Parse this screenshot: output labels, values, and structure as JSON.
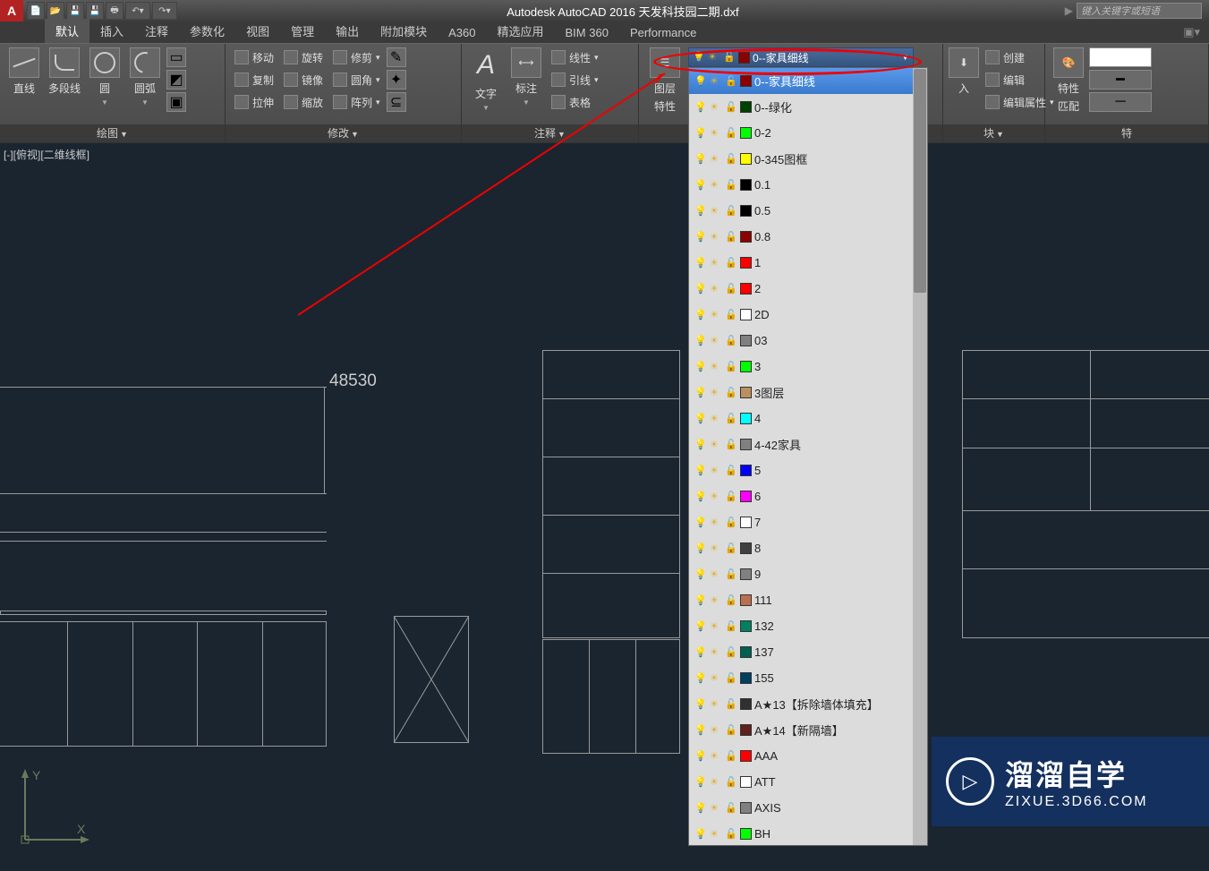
{
  "title": "Autodesk AutoCAD 2016   天发科技园二期.dxf",
  "search_placeholder": "键入关键字或短语",
  "tabs": [
    "默认",
    "插入",
    "注释",
    "参数化",
    "视图",
    "管理",
    "输出",
    "附加模块",
    "A360",
    "精选应用",
    "BIM 360",
    "Performance"
  ],
  "draw": {
    "line": "直线",
    "pline": "多段线",
    "circle": "圆",
    "arc": "圆弧",
    "panel": "绘图"
  },
  "modify": {
    "move": "移动",
    "copy": "复制",
    "stretch": "拉伸",
    "rotate": "旋转",
    "mirror": "镜像",
    "scale": "缩放",
    "trim": "修剪",
    "fillet": "圆角",
    "array": "阵列",
    "panel": "修改"
  },
  "annot": {
    "text": "文字",
    "dim": "标注",
    "linetype": "线性",
    "leader": "引线",
    "table": "表格",
    "panel": "注释"
  },
  "layer": {
    "props": "图层",
    "props2": "特性",
    "current": "0--家具细线"
  },
  "block": {
    "create": "创建",
    "edit": "编辑",
    "editattr": "编辑属性",
    "insert": "入",
    "panel": "块"
  },
  "prop": {
    "props": "特性",
    "match": "匹配"
  },
  "layers": [
    {
      "name": "0--家具细线",
      "color": "#8B0000"
    },
    {
      "name": "0--绿化",
      "color": "#004200"
    },
    {
      "name": "0-2",
      "color": "#00FF00"
    },
    {
      "name": "0-345图框",
      "color": "#FFFF00"
    },
    {
      "name": "0.1",
      "color": "#000000"
    },
    {
      "name": "0.5",
      "color": "#000000"
    },
    {
      "name": "0.8",
      "color": "#8B0000"
    },
    {
      "name": "1",
      "color": "#FF0000"
    },
    {
      "name": "2",
      "color": "#FF0000"
    },
    {
      "name": "2D",
      "color": "#FFFFFF"
    },
    {
      "name": "03",
      "color": "#808080"
    },
    {
      "name": "3",
      "color": "#00FF00"
    },
    {
      "name": "3图层",
      "color": "#BC8F60"
    },
    {
      "name": "4",
      "color": "#00FFFF"
    },
    {
      "name": "4-42家具",
      "color": "#808080"
    },
    {
      "name": "5",
      "color": "#0000FF"
    },
    {
      "name": "6",
      "color": "#FF00FF"
    },
    {
      "name": "7",
      "color": "#FFFFFF"
    },
    {
      "name": "8",
      "color": "#404040"
    },
    {
      "name": "9",
      "color": "#808080"
    },
    {
      "name": "111",
      "color": "#B87050"
    },
    {
      "name": "132",
      "color": "#008060"
    },
    {
      "name": "137",
      "color": "#006050"
    },
    {
      "name": "155",
      "color": "#004060"
    },
    {
      "name": "A★13【拆除墙体填充】",
      "color": "#303030"
    },
    {
      "name": "A★14【新隔墙】",
      "color": "#602020"
    },
    {
      "name": "AAA",
      "color": "#FF0000"
    },
    {
      "name": "ATT",
      "color": "#FFFFFF"
    },
    {
      "name": "AXIS",
      "color": "#808080"
    },
    {
      "name": "BH",
      "color": "#00FF00"
    }
  ],
  "canvas": {
    "viewlabel": "[-][俯视][二维线框]",
    "dimension": "48530"
  },
  "watermark": {
    "brand": "溜溜自学",
    "url": "ZIXUE.3D66.COM"
  },
  "ucs": {
    "x": "X",
    "y": "Y"
  }
}
